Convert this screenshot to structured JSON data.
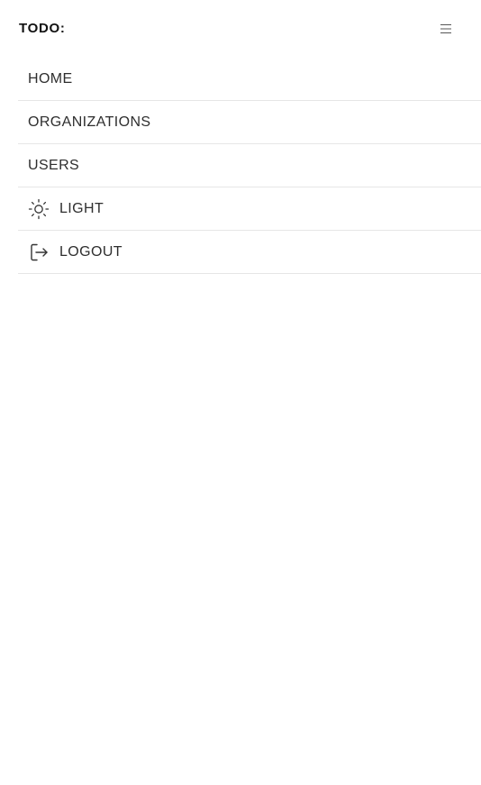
{
  "header": {
    "brand": "TODO:",
    "menu_icon": "hamburger-menu-icon"
  },
  "nav": {
    "items": [
      {
        "label": "HOME",
        "icon": null
      },
      {
        "label": "ORGANIZATIONS",
        "icon": null
      },
      {
        "label": "USERS",
        "icon": null
      },
      {
        "label": "LIGHT",
        "icon": "sun-icon"
      },
      {
        "label": "LOGOUT",
        "icon": "logout-icon"
      }
    ]
  },
  "colors": {
    "text": "#2e2e2e",
    "brand_text": "#111111",
    "divider": "#e6e6e6",
    "background": "#ffffff"
  }
}
